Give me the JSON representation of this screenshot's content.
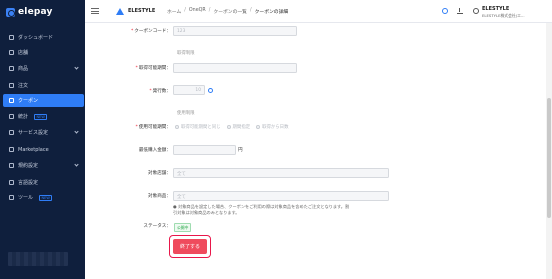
{
  "sidebar": {
    "logo": "elepay",
    "items": [
      {
        "label": "ダッシュボード",
        "icon": "dashboard-icon"
      },
      {
        "label": "店舗",
        "icon": "store-icon"
      },
      {
        "label": "商品",
        "icon": "product-icon"
      },
      {
        "label": "注文",
        "icon": "order-icon"
      },
      {
        "label": "クーポン",
        "icon": "coupon-icon",
        "active": true
      },
      {
        "label": "統計",
        "icon": "stats-icon",
        "badge": "NEW"
      },
      {
        "label": "サービス設定",
        "icon": "service-settings-icon"
      },
      {
        "label": "Marketplace",
        "icon": "marketplace-icon"
      },
      {
        "label": "規約設定",
        "icon": "terms-icon"
      },
      {
        "label": "言語設定",
        "icon": "language-icon"
      },
      {
        "label": "ツール",
        "icon": "tool-icon",
        "badge": "NEW"
      }
    ]
  },
  "header": {
    "store_name": "ELESTYLE",
    "breadcrumb": [
      "ホーム",
      "OneQR",
      "クーポンの一覧",
      "クーポンの詳細"
    ],
    "user_name": "ELESTYLE",
    "user_company": "ELESTYLE株式会社(エ..."
  },
  "form": {
    "coupon_code_label": "クーポンコード：",
    "coupon_code_value": "123",
    "acquire_section": "取得制限",
    "acquire_period_label": "取得可能期間：",
    "issue_count_label": "発行数：",
    "issue_count_value": "10",
    "usage_section": "使用制限",
    "usage_period_label": "使用可能期間：",
    "usage_options": [
      "取得可能期間と同じ",
      "期間指定",
      "取得から日数"
    ],
    "min_purchase_label": "最低購入金額：",
    "min_purchase_unit": "円",
    "target_store_label": "対象店舗：",
    "target_store_placeholder": "全て",
    "target_product_label": "対象商品：",
    "target_product_placeholder": "全て",
    "note_line1": "対象商品を設定した場合、クーポンをご利用の際は対象商品を含めたご注文となります。割",
    "note_line2": "引対象は対象商品のみとなります。",
    "status_label": "ステータス：",
    "status_value": "公開中",
    "end_button": "終了する"
  }
}
